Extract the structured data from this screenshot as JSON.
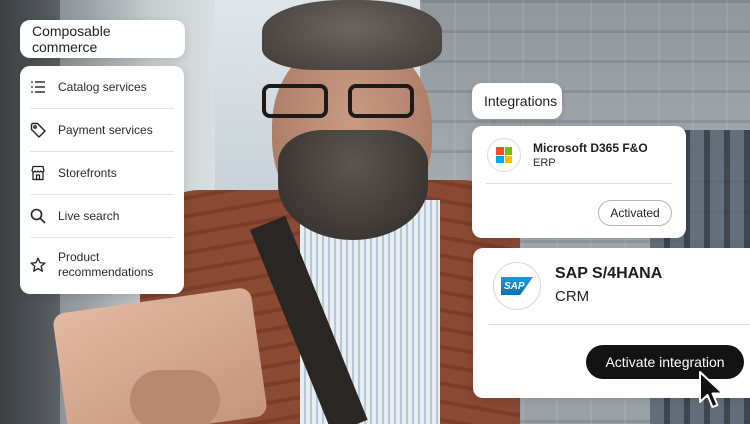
{
  "composable_commerce": {
    "title": "Composable commerce",
    "items": [
      {
        "label": "Catalog services",
        "icon": "list-icon"
      },
      {
        "label": "Payment services",
        "icon": "tag-icon"
      },
      {
        "label": "Storefronts",
        "icon": "storefront-icon"
      },
      {
        "label": "Live search",
        "icon": "search-icon"
      },
      {
        "label": "Product recommendations",
        "icon": "star-icon"
      }
    ]
  },
  "integrations": {
    "title": "Integrations",
    "microsoft": {
      "name": "Microsoft D365 F&O",
      "type": "ERP",
      "status_label": "Activated",
      "logo_colors": [
        "#f25022",
        "#7fba00",
        "#00a4ef",
        "#ffb900"
      ]
    },
    "sap": {
      "logo_text": "SAP",
      "name": "SAP S/4HANA",
      "type": "CRM",
      "action_label": "Activate integration",
      "brand_color": "#0b6fb5"
    }
  }
}
